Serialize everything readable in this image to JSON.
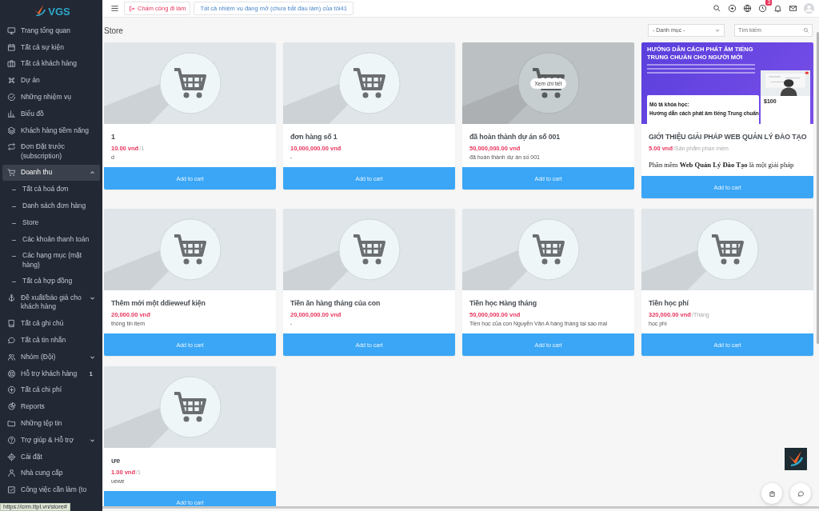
{
  "sidebar": {
    "logo": "VGS",
    "items": [
      {
        "kind": "link",
        "label": "Trang tổng quan",
        "selected": false
      },
      {
        "kind": "link",
        "label": "Tất cả sự kiện",
        "selected": false
      },
      {
        "kind": "link",
        "label": "Tất cả khách hàng",
        "selected": false
      },
      {
        "kind": "link",
        "label": "Dự án",
        "selected": false
      },
      {
        "kind": "link",
        "label": "Những nhiệm vụ",
        "selected": false
      },
      {
        "kind": "link",
        "label": "Biểu đồ",
        "selected": false
      },
      {
        "kind": "link",
        "label": "Khách hàng tiềm năng",
        "selected": false
      },
      {
        "kind": "link",
        "label": "Đơn Đặt trước (subscription)",
        "selected": false
      },
      {
        "kind": "group",
        "label": "Doanh thu",
        "selected": true,
        "expanded": true,
        "children": [
          {
            "label": "Tất cả hoá đơn"
          },
          {
            "label": "Danh sách đơn hàng"
          },
          {
            "label": "Store"
          },
          {
            "label": "Các khoản thanh toán"
          },
          {
            "label": "Các hạng mục (mặt hàng)"
          },
          {
            "label": "Tất cả hợp đồng"
          }
        ]
      },
      {
        "kind": "group",
        "label": "Đề xuất/báo giá cho khách hàng",
        "selected": false,
        "expanded": false
      },
      {
        "kind": "link",
        "label": "Tất cả ghi chú",
        "selected": false
      },
      {
        "kind": "link",
        "label": "Tất cả tin nhắn",
        "selected": false
      },
      {
        "kind": "group",
        "label": "Nhóm (Đội)",
        "selected": false,
        "expanded": false
      },
      {
        "kind": "link",
        "label": "Hỗ trợ khách hàng",
        "selected": false,
        "badge": "1"
      },
      {
        "kind": "link",
        "label": "Tất cả chi phí",
        "selected": false
      },
      {
        "kind": "link",
        "label": "Reports",
        "selected": false
      },
      {
        "kind": "link",
        "label": "Những tệp tin",
        "selected": false
      },
      {
        "kind": "group",
        "label": "Trợ giúp & Hỗ trợ",
        "selected": false,
        "expanded": false
      },
      {
        "kind": "link",
        "label": "Cài đặt",
        "selected": false
      },
      {
        "kind": "link",
        "label": "Nhà cung cấp",
        "selected": false
      },
      {
        "kind": "link",
        "label": "Công việc cần làm (to",
        "selected": false
      }
    ]
  },
  "status_url": "https://crm.ttpl.vn/store#",
  "topbar": {
    "clock_in_button": "Chấm công đi làm",
    "tasks_link": "Tất cả nhiệm vụ đang mở (chưa bắt đầu làm) của tôi41",
    "reminder_badge": "3"
  },
  "page": {
    "title": "Store",
    "category_select": "- Danh mục -",
    "search": {
      "placeholder": "Tìm kiếm"
    }
  },
  "products": [
    {
      "kind": "placeholder",
      "hovered": false,
      "title": "1",
      "price": "10.00 vnđ",
      "unit": "/1",
      "description": "d",
      "button": "Add to cart"
    },
    {
      "kind": "placeholder",
      "hovered": false,
      "title": "đơn hàng số 1",
      "price": "10,000,000.00 vnđ",
      "description": "-",
      "button": "Add to cart"
    },
    {
      "kind": "placeholder",
      "hovered": true,
      "overlay_label": "Xem chi tiết",
      "title": "đã hoàn thành dự án số 001",
      "price": "50,000,000.00 vnđ",
      "description": "đã hoàn thành dự án số 001",
      "button": "Add to cart"
    },
    {
      "kind": "banner",
      "hovered": false,
      "banner": {
        "heading": "HƯỚNG DẪN CÁCH PHÁT ÂM TIẾNG TRUNG CHUẨN CHO NGƯỜI MỚI",
        "price": "$100",
        "section": "Mô tả khóa học:",
        "course": "Hướng dẫn cách phát âm tiếng Trung chuẩn"
      },
      "title": "GIỚI THIỆU GIẢI PHÁP WEB QUẢN LÝ ĐÀO TẠO",
      "price": "5.00 vnđ",
      "unit": "/Sản phẩm phần mềm",
      "rich_description": "Phần mềm **Web Quản Lý Đào Tạo** là một giải pháp",
      "button": "Add to cart"
    },
    {
      "kind": "placeholder",
      "hovered": false,
      "title": "Thêm mới một ddieweuf kiện",
      "price": "20,000.00 vnđ",
      "description": "thông tin item",
      "button": "Add to cart"
    },
    {
      "kind": "placeholder",
      "hovered": false,
      "title": "Tiền ăn hàng tháng của con",
      "price": "20,000,000.00 vnđ",
      "description": "-",
      "button": "Add to cart"
    },
    {
      "kind": "placeholder",
      "hovered": false,
      "title": "Tiền học Hàng tháng",
      "price": "50,000,000.00 vnđ",
      "description": "Tiền học của con Nguyễn Văn A hàng tháng tại sao mai",
      "button": "Add to cart"
    },
    {
      "kind": "placeholder",
      "hovered": false,
      "title": "Tiền học phí",
      "price": "320,000.00 vnđ",
      "unit": "/Tháng",
      "description": "học phí",
      "button": "Add to cart"
    },
    {
      "kind": "placeholder",
      "hovered": false,
      "title": "ưe",
      "price": "1.00 vnđ",
      "unit": "/1",
      "description": "uewe",
      "button": "Add to cart"
    }
  ]
}
